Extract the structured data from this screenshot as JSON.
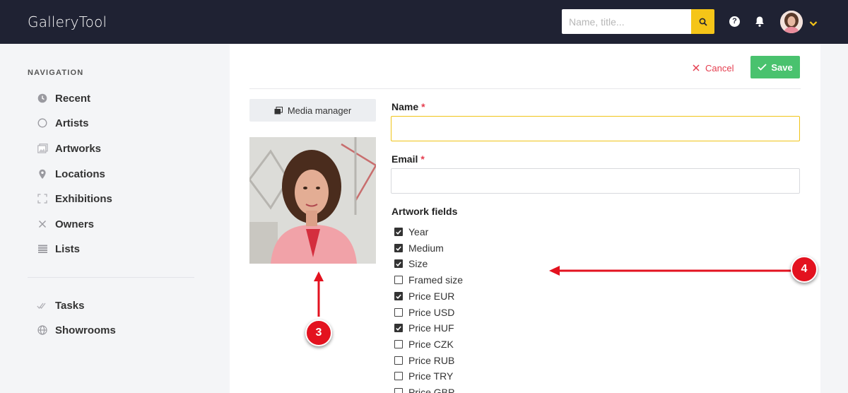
{
  "app": {
    "title": "GalleryTool"
  },
  "search": {
    "placeholder": "Name, title..."
  },
  "header": {
    "help_symbol": "?"
  },
  "sidebar": {
    "heading": "NAVIGATION",
    "items": [
      {
        "label": "Recent",
        "icon": "clock-icon"
      },
      {
        "label": "Artists",
        "icon": "circle-icon"
      },
      {
        "label": "Artworks",
        "icon": "image-icon"
      },
      {
        "label": "Locations",
        "icon": "map-pin-icon"
      },
      {
        "label": "Exhibitions",
        "icon": "expand-icon"
      },
      {
        "label": "Owners",
        "icon": "close-icon"
      },
      {
        "label": "Lists",
        "icon": "list-icon"
      }
    ],
    "secondary": [
      {
        "label": "Tasks",
        "icon": "double-check-icon"
      },
      {
        "label": "Showrooms",
        "icon": "globe-icon"
      }
    ]
  },
  "toolbar": {
    "cancel_label": "Cancel",
    "save_label": "Save"
  },
  "media": {
    "button_label": "Media manager"
  },
  "form": {
    "name_label": "Name",
    "name_value": "",
    "email_label": "Email",
    "email_value": "",
    "required_mark": "*",
    "artwork_fields_label": "Artwork fields",
    "fields": [
      {
        "label": "Year",
        "checked": true
      },
      {
        "label": "Medium",
        "checked": true
      },
      {
        "label": "Size",
        "checked": true
      },
      {
        "label": "Framed size",
        "checked": false
      },
      {
        "label": "Price EUR",
        "checked": true
      },
      {
        "label": "Price USD",
        "checked": false
      },
      {
        "label": "Price HUF",
        "checked": true
      },
      {
        "label": "Price CZK",
        "checked": false
      },
      {
        "label": "Price RUB",
        "checked": false
      },
      {
        "label": "Price TRY",
        "checked": false
      },
      {
        "label": "Price GBP",
        "checked": false
      }
    ]
  },
  "annotations": [
    {
      "number": "3"
    },
    {
      "number": "4"
    }
  ],
  "colors": {
    "topbar": "#1f2233",
    "accent": "#f5c518",
    "save": "#49c26e",
    "cancel": "#e53e4f",
    "annotation": "#e3121f"
  }
}
